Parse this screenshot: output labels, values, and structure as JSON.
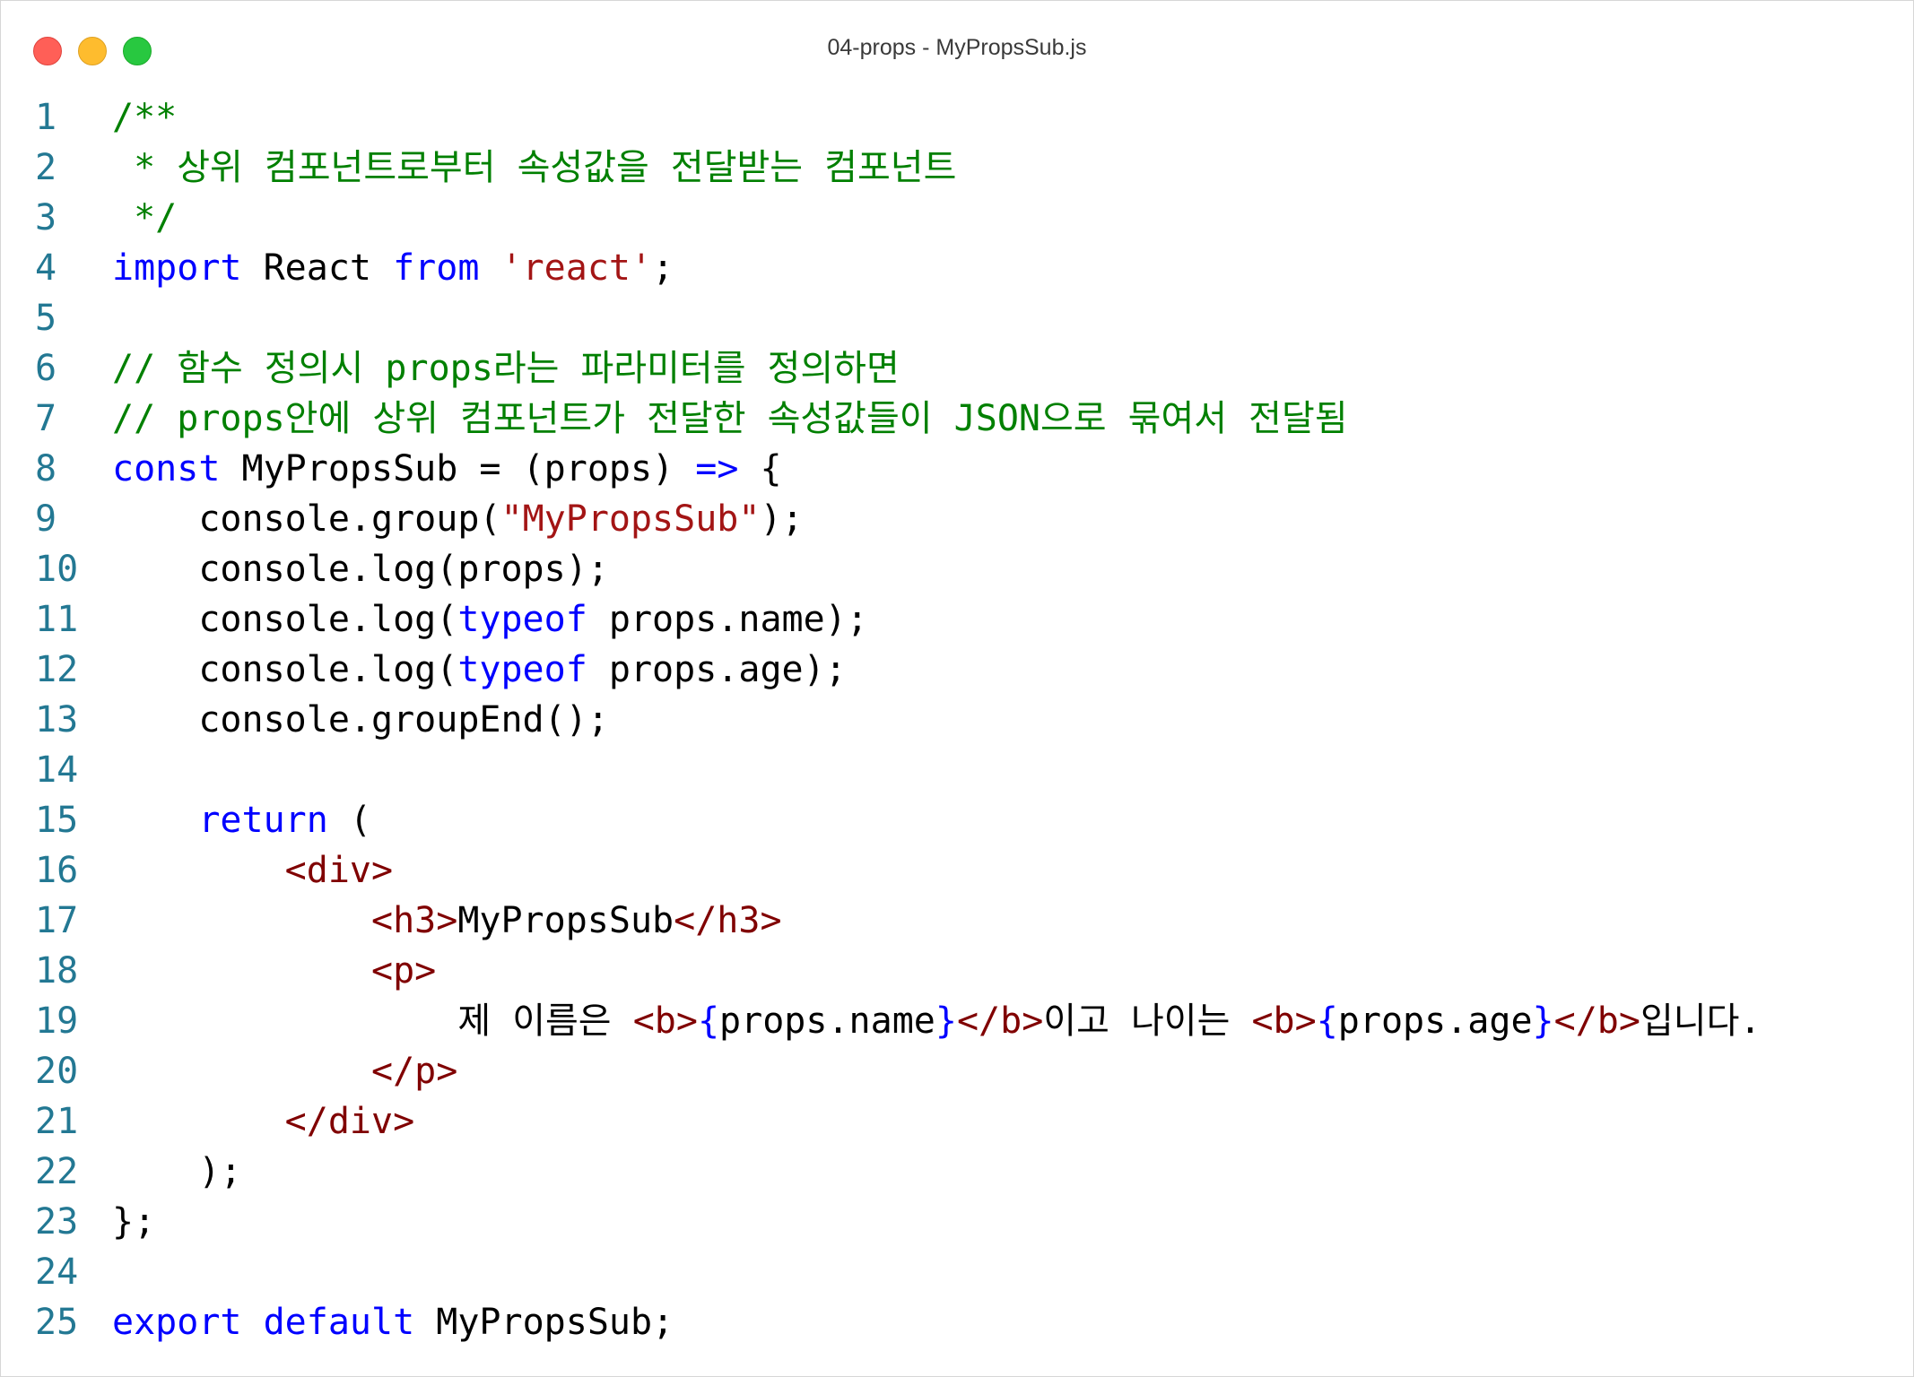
{
  "window": {
    "title": "04-props - MyPropsSub.js"
  },
  "colors": {
    "comment": "#008000",
    "keyword": "#0000ff",
    "string": "#a31515",
    "tag": "#800000",
    "plain": "#000000",
    "line_number": "#237893"
  },
  "code": {
    "lines": [
      {
        "n": "1",
        "tokens": [
          {
            "t": "comment",
            "v": "/**"
          }
        ]
      },
      {
        "n": "2",
        "tokens": [
          {
            "t": "comment",
            "v": " * 상위 컴포넌트로부터 속성값을 전달받는 컴포넌트"
          }
        ]
      },
      {
        "n": "3",
        "tokens": [
          {
            "t": "comment",
            "v": " */"
          }
        ]
      },
      {
        "n": "4",
        "tokens": [
          {
            "t": "keyword",
            "v": "import"
          },
          {
            "t": "plain",
            "v": " React "
          },
          {
            "t": "keyword",
            "v": "from"
          },
          {
            "t": "plain",
            "v": " "
          },
          {
            "t": "string",
            "v": "'react'"
          },
          {
            "t": "plain",
            "v": ";"
          }
        ]
      },
      {
        "n": "5",
        "tokens": []
      },
      {
        "n": "6",
        "tokens": [
          {
            "t": "comment",
            "v": "// 함수 정의시 props라는 파라미터를 정의하면"
          }
        ]
      },
      {
        "n": "7",
        "tokens": [
          {
            "t": "comment",
            "v": "// props안에 상위 컴포넌트가 전달한 속성값들이 JSON으로 묶여서 전달됨"
          }
        ]
      },
      {
        "n": "8",
        "tokens": [
          {
            "t": "keyword",
            "v": "const"
          },
          {
            "t": "plain",
            "v": " MyPropsSub = (props) "
          },
          {
            "t": "keyword",
            "v": "=>"
          },
          {
            "t": "plain",
            "v": " {"
          }
        ]
      },
      {
        "n": "9",
        "tokens": [
          {
            "t": "plain",
            "v": "    console.group("
          },
          {
            "t": "string",
            "v": "\"MyPropsSub\""
          },
          {
            "t": "plain",
            "v": ");"
          }
        ]
      },
      {
        "n": "10",
        "tokens": [
          {
            "t": "plain",
            "v": "    console.log(props);"
          }
        ]
      },
      {
        "n": "11",
        "tokens": [
          {
            "t": "plain",
            "v": "    console.log("
          },
          {
            "t": "keyword",
            "v": "typeof"
          },
          {
            "t": "plain",
            "v": " props.name);"
          }
        ]
      },
      {
        "n": "12",
        "tokens": [
          {
            "t": "plain",
            "v": "    console.log("
          },
          {
            "t": "keyword",
            "v": "typeof"
          },
          {
            "t": "plain",
            "v": " props.age);"
          }
        ]
      },
      {
        "n": "13",
        "tokens": [
          {
            "t": "plain",
            "v": "    console.groupEnd();"
          }
        ]
      },
      {
        "n": "14",
        "tokens": []
      },
      {
        "n": "15",
        "tokens": [
          {
            "t": "plain",
            "v": "    "
          },
          {
            "t": "keyword",
            "v": "return"
          },
          {
            "t": "plain",
            "v": " ("
          }
        ]
      },
      {
        "n": "16",
        "tokens": [
          {
            "t": "plain",
            "v": "        "
          },
          {
            "t": "tag",
            "v": "<div>"
          }
        ]
      },
      {
        "n": "17",
        "tokens": [
          {
            "t": "plain",
            "v": "            "
          },
          {
            "t": "tag",
            "v": "<h3>"
          },
          {
            "t": "plain",
            "v": "MyPropsSub"
          },
          {
            "t": "tag",
            "v": "</h3>"
          }
        ]
      },
      {
        "n": "18",
        "tokens": [
          {
            "t": "plain",
            "v": "            "
          },
          {
            "t": "tag",
            "v": "<p>"
          }
        ]
      },
      {
        "n": "19",
        "tokens": [
          {
            "t": "plain",
            "v": "                제 이름은 "
          },
          {
            "t": "tag",
            "v": "<b>"
          },
          {
            "t": "keyword",
            "v": "{"
          },
          {
            "t": "plain",
            "v": "props.name"
          },
          {
            "t": "keyword",
            "v": "}"
          },
          {
            "t": "tag",
            "v": "</b>"
          },
          {
            "t": "plain",
            "v": "이고 나이는 "
          },
          {
            "t": "tag",
            "v": "<b>"
          },
          {
            "t": "keyword",
            "v": "{"
          },
          {
            "t": "plain",
            "v": "props.age"
          },
          {
            "t": "keyword",
            "v": "}"
          },
          {
            "t": "tag",
            "v": "</b>"
          },
          {
            "t": "plain",
            "v": "입니다."
          }
        ]
      },
      {
        "n": "20",
        "tokens": [
          {
            "t": "plain",
            "v": "            "
          },
          {
            "t": "tag",
            "v": "</p>"
          }
        ]
      },
      {
        "n": "21",
        "tokens": [
          {
            "t": "plain",
            "v": "        "
          },
          {
            "t": "tag",
            "v": "</div>"
          }
        ]
      },
      {
        "n": "22",
        "tokens": [
          {
            "t": "plain",
            "v": "    );"
          }
        ]
      },
      {
        "n": "23",
        "tokens": [
          {
            "t": "plain",
            "v": "};"
          }
        ]
      },
      {
        "n": "24",
        "tokens": []
      },
      {
        "n": "25",
        "tokens": [
          {
            "t": "keyword",
            "v": "export"
          },
          {
            "t": "plain",
            "v": " "
          },
          {
            "t": "keyword",
            "v": "default"
          },
          {
            "t": "plain",
            "v": " MyPropsSub;"
          }
        ]
      }
    ]
  }
}
